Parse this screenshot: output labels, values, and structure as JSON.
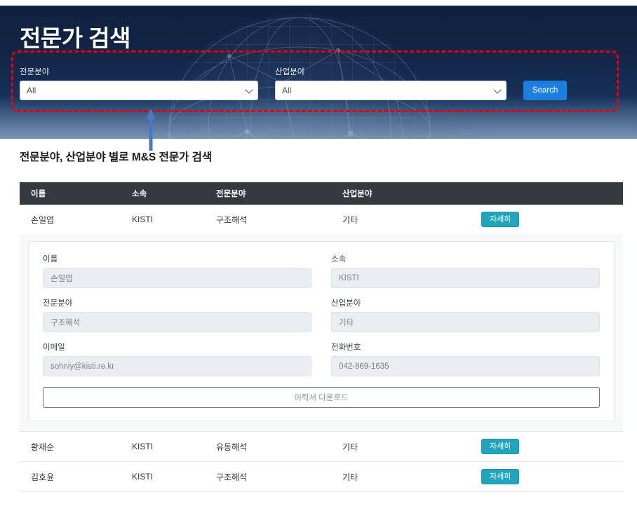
{
  "hero": {
    "title": "전문가 검색",
    "globe_icon": "globe-network-icon"
  },
  "search": {
    "expertise": {
      "label": "전문분야",
      "value": "All",
      "options": [
        "All"
      ],
      "caret_icon": "chevron-down-icon"
    },
    "industry": {
      "label": "산업분야",
      "value": "All",
      "options": [
        "All"
      ],
      "caret_icon": "chevron-down-icon"
    },
    "search_button": "Search"
  },
  "annotation": {
    "highlight_color": "#e8000b",
    "arrow_color": "#4a78c8",
    "arrow_icon": "up-arrow-icon"
  },
  "caption": "전문분야, 산업분야 별로 M&S 전문가 검색",
  "table": {
    "columns": [
      "이름",
      "소속",
      "전문분야",
      "산업분야"
    ],
    "action_label": "자세히",
    "action_color": "#1fa5bd",
    "rows": [
      {
        "name": "손일엽",
        "org": "KISTI",
        "field": "구조해석",
        "industry": "기타",
        "expanded": true
      },
      {
        "name": "황재순",
        "org": "KISTI",
        "field": "유동해석",
        "industry": "기타",
        "expanded": false
      },
      {
        "name": "김호윤",
        "org": "KISTI",
        "field": "구조해석",
        "industry": "기타",
        "expanded": false
      }
    ]
  },
  "detail": {
    "name_label": "이름",
    "name_value": "손일엽",
    "org_label": "소속",
    "org_value": "KISTI",
    "field_label": "전문분야",
    "field_value": "구조해석",
    "industry_label": "산업분야",
    "industry_value": "기타",
    "email_label": "이메일",
    "email_value": "sohniy@kisti.re.kr",
    "phone_label": "전화번호",
    "phone_value": "042-869-1635",
    "download_label": "이력서 다운로드"
  }
}
